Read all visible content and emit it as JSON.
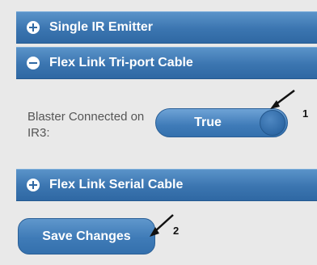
{
  "accordion": {
    "sections": [
      {
        "title": "Single IR Emitter",
        "state": "collapsed"
      },
      {
        "title": "Flex Link Tri-port Cable",
        "state": "expanded"
      },
      {
        "title": "Flex Link Serial Cable",
        "state": "collapsed"
      }
    ]
  },
  "setting": {
    "label": "Blaster Connected on IR3:",
    "toggle_value": "True"
  },
  "save_button": {
    "label": "Save Changes"
  },
  "annotations": [
    {
      "number": "1"
    },
    {
      "number": "2"
    }
  ],
  "colors": {
    "accent": "#3b75b0",
    "background": "#e9e9e9",
    "label_text": "#555555"
  },
  "icons": {
    "collapsed": "plus-circle-icon",
    "expanded": "minus-circle-icon"
  }
}
